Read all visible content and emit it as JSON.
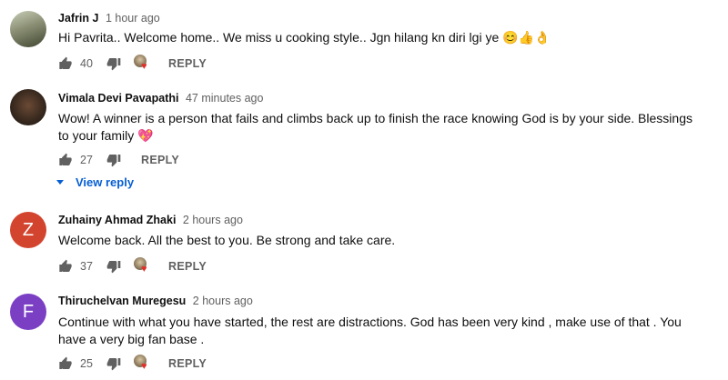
{
  "comments": [
    {
      "author": "Jafrin J",
      "time": "1 hour ago",
      "text": "Hi Pavrita.. Welcome home.. We miss u cooking style.. Jgn hilang kn diri lgi ye 😊👍👌",
      "likes": "40",
      "avatar": "photo",
      "creator_heart": true,
      "reply_label": "REPLY"
    },
    {
      "author": "Vimala Devi Pavapathi",
      "time": "47 minutes ago",
      "text": "Wow! A winner is a person that fails and climbs back up to finish the race knowing God is by your side. Blessings to your family 💖",
      "likes": "27",
      "avatar": "photo",
      "creator_heart": false,
      "reply_label": "REPLY",
      "view_reply_label": "View reply"
    },
    {
      "author": "Zuhainy Ahmad Zhaki",
      "time": "2 hours ago",
      "text": "Welcome back. All the best to you. Be strong and take care.",
      "likes": "37",
      "avatar": "Z",
      "avatar_color": "#d3442f",
      "creator_heart": true,
      "reply_label": "REPLY"
    },
    {
      "author": "Thiruchelvan Muregesu",
      "time": "2 hours ago",
      "text": "Continue with what you have started, the rest are distractions. God has been very kind , make use of that . You have a very big fan base .",
      "likes": "25",
      "avatar": "F",
      "avatar_color": "#7b3fc4",
      "creator_heart": true,
      "reply_label": "REPLY"
    }
  ],
  "icons": {
    "like": "thumb-up-icon",
    "dislike": "thumb-down-icon",
    "creator_heart": "creator-heart-icon",
    "expand": "caret-down-icon"
  },
  "colors": {
    "link_blue": "#065fd4",
    "heart_red": "#e0302a",
    "meta_gray": "#606060"
  }
}
